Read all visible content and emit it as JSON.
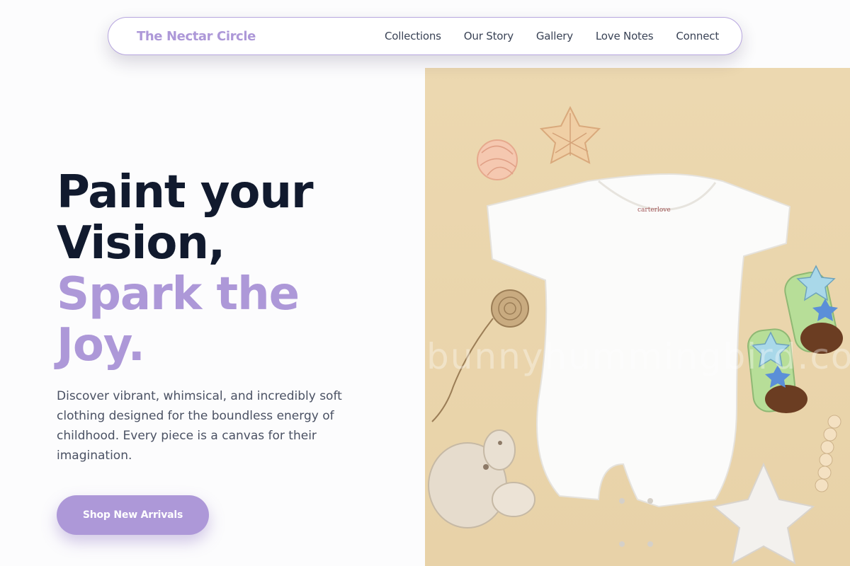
{
  "brand": {
    "name": "The Nectar Circle"
  },
  "nav": {
    "links": [
      {
        "label": "Collections"
      },
      {
        "label": "Our Story"
      },
      {
        "label": "Gallery"
      },
      {
        "label": "Love Notes"
      },
      {
        "label": "Connect"
      }
    ]
  },
  "hero": {
    "headline_line1": "Paint your",
    "headline_line2": "Vision,",
    "headline_line3": "Spark the",
    "headline_line4": "Joy.",
    "description": "Discover vibrant, whimsical, and incredibly soft clothing designed for the boundless energy of childhood. Every piece is a canvas for their imagination.",
    "cta_label": "Shop New Arrivals"
  },
  "image": {
    "label_text": "carterlove",
    "watermark_text": "bunnyhummingbird.com"
  },
  "colors": {
    "accent": "#ad98d8",
    "headline_dark": "#111a2e",
    "body_text": "#4a5163",
    "image_background": "#ead6ae"
  },
  "icons": {
    "decorations": [
      "star-toy-icon",
      "yarn-ball-icon",
      "twine-icon",
      "plush-bunny-icon",
      "baby-socks-icon",
      "bead-rattle-icon",
      "plush-star-icon"
    ]
  }
}
